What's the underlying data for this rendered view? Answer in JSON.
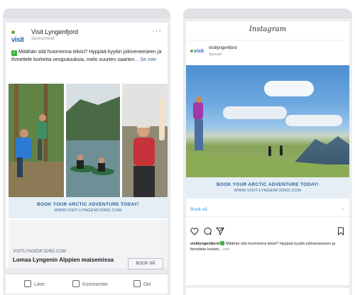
{
  "facebook": {
    "page_name": "Visit Lyngenfjord",
    "logo_text": "visit",
    "sponsored": "Sponsoreret",
    "more": "···",
    "post_text": "Mitähän sitä huomenna tekisi? Hyppää kyytiin jokiveneeseen ja ihmettele korkeita vesiputouksia, melo suurten saarten...",
    "see_more": "Se mer",
    "banner_main": "BOOK YOUR ARCTIC ADVENTURE TODAY!",
    "banner_url": "WWW.VISIT-LYNGENFJORD.COM",
    "link_domain": "VISITLYNGENFJORD.COM",
    "link_headline": "Lomaa Lyngenin Alppien maisemissa",
    "cta": "BOOK NÅ",
    "actions": [
      "Liker",
      "Kommenter",
      "Del"
    ]
  },
  "instagram": {
    "brand": "Instagram",
    "logo_text": "visit",
    "username": "visitlyngenfjord",
    "sponsored": "Sponset",
    "banner_main": "BOOK YOUR ARCTIC ADVENTURE TODAY!",
    "banner_url": "WWW.VISIT-LYNGENFJORD.COM",
    "cta": "Book nå",
    "cta_arrow": "›",
    "caption_user": "visitlyngenfjord",
    "caption_text": "Mitähän sitä huomenna tekisi? Hyppää kyytiin jokiveneeseen ja ihmettele korkeit...",
    "caption_more": "mer"
  },
  "colors": {
    "brand_blue": "#2a6db5",
    "brand_green": "#6aaa3a",
    "banner_bg": "#e4eef4",
    "link_blue": "#3897f0"
  }
}
